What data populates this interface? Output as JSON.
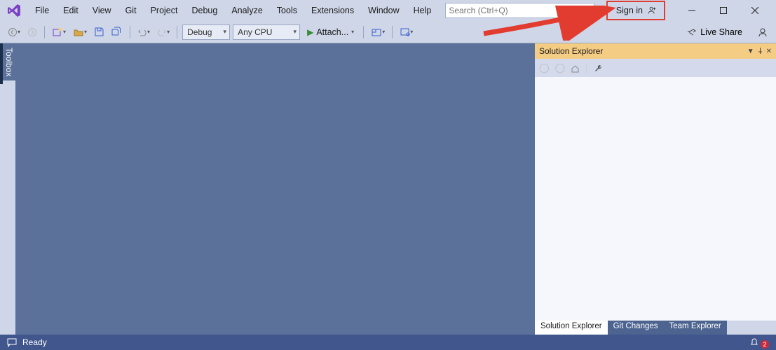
{
  "menu": [
    "File",
    "Edit",
    "View",
    "Git",
    "Project",
    "Debug",
    "Analyze",
    "Tools",
    "Extensions",
    "Window",
    "Help"
  ],
  "search": {
    "placeholder": "Search (Ctrl+Q)"
  },
  "signin": {
    "label": "Sign in"
  },
  "toolbar": {
    "config": "Debug",
    "platform": "Any CPU",
    "attach": "Attach..."
  },
  "liveshare": "Live Share",
  "toolbox_tab": "Toolbox",
  "solution_explorer": {
    "title": "Solution Explorer",
    "tabs": [
      "Solution Explorer",
      "Git Changes",
      "Team Explorer"
    ]
  },
  "status": {
    "ready": "Ready",
    "notifications": "2"
  }
}
